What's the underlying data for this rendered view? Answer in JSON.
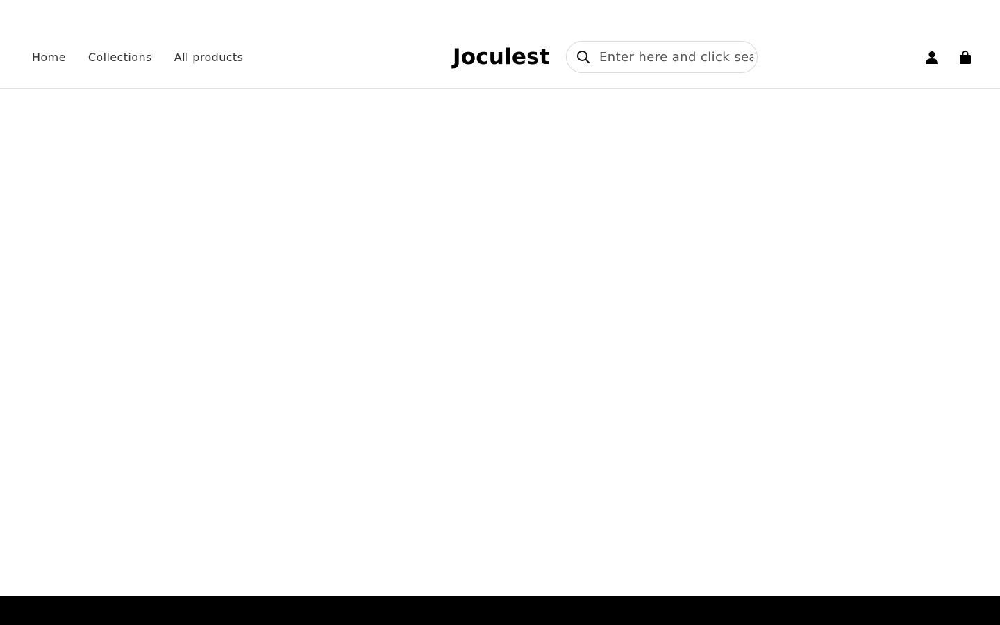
{
  "header": {
    "nav": [
      {
        "label": "Home"
      },
      {
        "label": "Collections"
      },
      {
        "label": "All products"
      }
    ],
    "logo": "Joculest",
    "search": {
      "placeholder": "Enter here and click search",
      "icon": "search-icon"
    },
    "icons": {
      "account": "user-icon",
      "cart": "shopping-bag-icon"
    }
  },
  "colors": {
    "background": "#ffffff",
    "text": "#1a1a1a",
    "border": "#e2e2e2",
    "footer": "#000000"
  }
}
